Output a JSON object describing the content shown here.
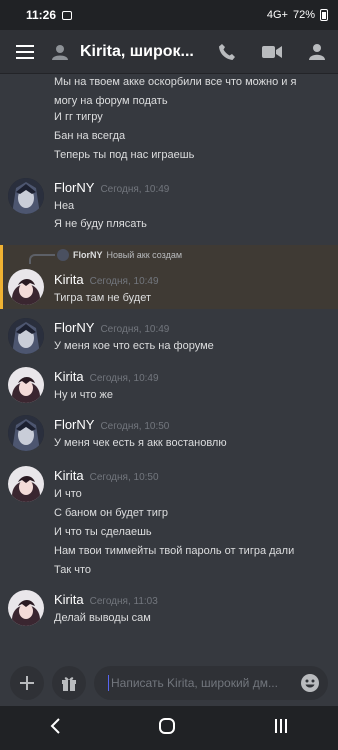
{
  "status_bar": {
    "time": "11:26",
    "signal": "4G+",
    "battery": "72%"
  },
  "header": {
    "title": "Kirita, широк..."
  },
  "messages": [
    {
      "lines": [
        "Мы на твоем акке оскорбили все что можно и я",
        "могу на форум подать",
        "И гг тигру",
        "Бан на всегда",
        "Теперь ты под нас играешь"
      ]
    },
    {
      "author": "FlorNY",
      "timestamp": "Сегодня, 10:49",
      "lines": [
        "Неа",
        "Я не буду плясать"
      ]
    },
    {
      "reply_to": {
        "author": "FlorNY",
        "text": "Новый акк создам"
      },
      "author": "Kirita",
      "timestamp": "Сегодня, 10:49",
      "lines": [
        "Тигра там не будет"
      ]
    },
    {
      "author": "FlorNY",
      "timestamp": "Сегодня, 10:49",
      "lines": [
        "У меня кое что есть на форуме"
      ]
    },
    {
      "author": "Kirita",
      "timestamp": "Сегодня, 10:49",
      "lines": [
        "Ну и что же"
      ]
    },
    {
      "author": "FlorNY",
      "timestamp": "Сегодня, 10:50",
      "lines": [
        "У меня чек есть я акк востановлю"
      ]
    },
    {
      "author": "Kirita",
      "timestamp": "Сегодня, 10:50",
      "lines": [
        "И что",
        "С баном он будет тигр",
        "И что ты сделаешь",
        "Нам твои тиммейты твой пароль от тигра дали",
        "Так что"
      ]
    },
    {
      "author": "Kirita",
      "timestamp": "Сегодня, 11:03",
      "lines": [
        "Делай выводы сам"
      ]
    }
  ],
  "composer": {
    "placeholder": "Написать Kirita, широкий дм..."
  },
  "icons": [
    "menu-icon",
    "user-icon",
    "call-icon",
    "video-icon",
    "members-icon",
    "plus-icon",
    "gift-icon",
    "emoji-icon",
    "back-icon",
    "home-icon",
    "recents-icon"
  ]
}
